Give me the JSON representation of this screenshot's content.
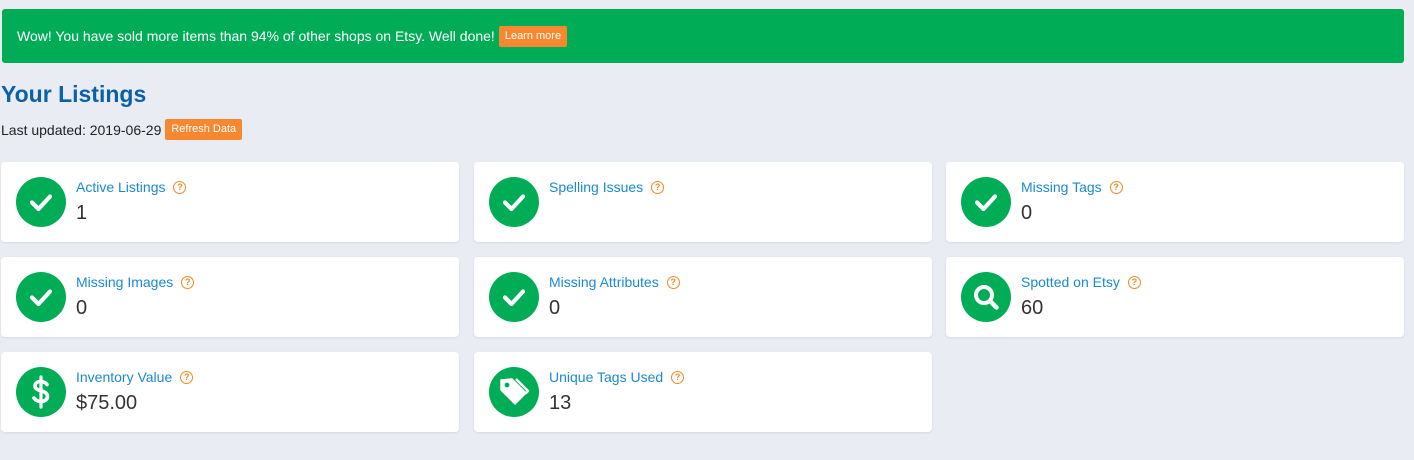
{
  "banner": {
    "message": "Wow! You have sold more items than 94% of other shops on Etsy. Well done!",
    "button_label": "Learn more"
  },
  "header": {
    "title": "Your Listings",
    "last_updated": "Last updated: 2019-06-29",
    "refresh_label": "Refresh Data"
  },
  "colors": {
    "accent_green": "#00ad56",
    "orange": "#f7882f",
    "title_blue": "#0a61a8",
    "link_blue": "#1a8ad0"
  },
  "cards": [
    {
      "label": "Active Listings",
      "value": "1",
      "icon": "check-icon"
    },
    {
      "label": "Spelling Issues",
      "value": "",
      "icon": "check-icon"
    },
    {
      "label": "Missing Tags",
      "value": "0",
      "icon": "check-icon"
    },
    {
      "label": "Missing Images",
      "value": "0",
      "icon": "check-icon"
    },
    {
      "label": "Missing Attributes",
      "value": "0",
      "icon": "check-icon"
    },
    {
      "label": "Spotted on Etsy",
      "value": "60",
      "icon": "search-icon"
    },
    {
      "label": "Inventory Value",
      "value": "$75.00",
      "icon": "dollar-icon"
    },
    {
      "label": "Unique Tags Used",
      "value": "13",
      "icon": "tag-icon"
    }
  ],
  "help_glyph": "?"
}
